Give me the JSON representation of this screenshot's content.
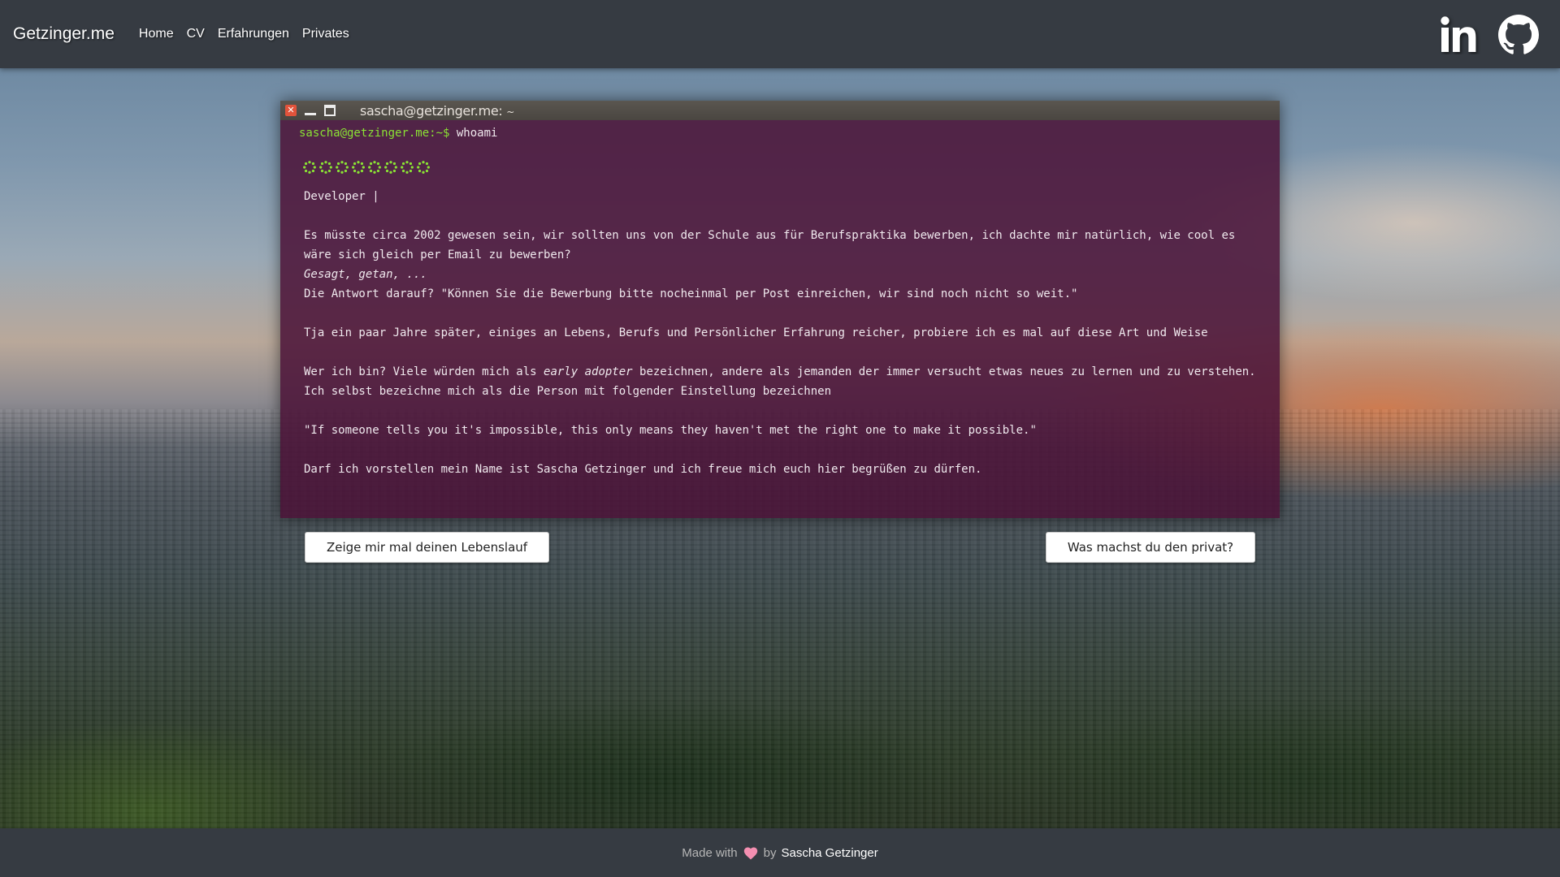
{
  "header": {
    "brand": "Getzinger.me",
    "nav": [
      "Home",
      "CV",
      "Erfahrungen",
      "Privates"
    ],
    "social": [
      "linkedin-icon",
      "github-icon"
    ]
  },
  "terminal": {
    "title": "sascha@getzinger.me:",
    "title_suffix": "~",
    "prompt": "sascha@getzinger.me:~$",
    "command": "whoami",
    "star_count": 8,
    "role": "Developer |",
    "paragraphs": [
      "Es müsste circa 2002 gewesen sein, wir sollten uns von der Schule aus für Berufspraktika bewerben, ich dachte mir natürlich, wie cool es wäre sich gleich per Email zu bewerben?",
      "Gesagt, getan, ...",
      "Die Antwort darauf? \"Können Sie die Bewerbung bitte nocheinmal per Post einreichen, wir sind noch nicht so weit.\"",
      "Tja ein paar Jahre später, einiges an Lebens, Berufs und Persönlicher Erfahrung reicher, probiere ich es mal auf diese Art und Weise",
      "Wer ich bin? Viele würden mich als ",
      "early adopter",
      " bezeichnen, andere als jemanden der immer versucht etwas neues zu lernen und zu verstehen.",
      "Ich selbst bezeichne mich als die Person mit folgender Einstellung bezeichnen",
      "\"If someone tells you it's impossible, this only means they haven't met the right one to make it possible.\"",
      "Darf ich vorstellen mein Name ist Sascha Getzinger und ich freue mich euch hier begrüßen zu dürfen."
    ]
  },
  "buttons": {
    "cv": "Zeige mir mal deinen Lebenslauf",
    "private": "Was machst du den privat?"
  },
  "footer": {
    "made_with": "Made with",
    "by": "by",
    "author": "Sascha Getzinger",
    "heart_color": "#f48fb1"
  }
}
